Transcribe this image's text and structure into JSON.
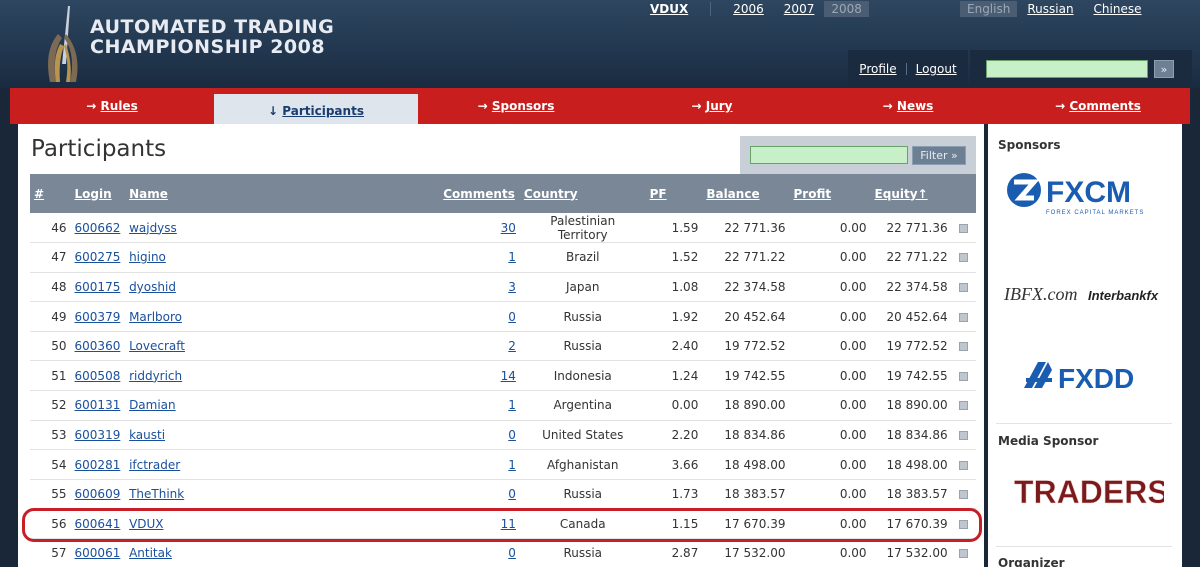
{
  "header": {
    "logo_line1": "AUTOMATED TRADING",
    "logo_line2": "CHAMPIONSHIP 2008",
    "user": "VDUX",
    "years": [
      "2006",
      "2007",
      "2008"
    ],
    "active_year": "2008",
    "languages": [
      "English",
      "Russian",
      "Chinese"
    ],
    "active_language": "English",
    "profile_label": "Profile",
    "logout_label": "Logout",
    "search_placeholder": "",
    "search_go": "»"
  },
  "nav": {
    "items": [
      {
        "label": "Rules",
        "arrow": "→"
      },
      {
        "label": "Participants",
        "arrow": "↓"
      },
      {
        "label": "Sponsors",
        "arrow": "→"
      },
      {
        "label": "Jury",
        "arrow": "→"
      },
      {
        "label": "News",
        "arrow": "→"
      },
      {
        "label": "Comments",
        "arrow": "→"
      }
    ]
  },
  "main": {
    "title": "Participants",
    "filter_label": "Filter »",
    "columns": {
      "num": "#",
      "login": "Login",
      "name": "Name",
      "comments": "Comments",
      "country": "Country",
      "pf": "PF",
      "balance": "Balance",
      "profit": "Profit",
      "equity": "Equity↑"
    },
    "rows": [
      {
        "num": "46",
        "login": "600662",
        "name": "wajdyss",
        "comments": "30",
        "country": "Palestinian Territory",
        "pf": "1.59",
        "balance": "22 771.36",
        "profit": "0.00",
        "equity": "22 771.36"
      },
      {
        "num": "47",
        "login": "600275",
        "name": "higino",
        "comments": "1",
        "country": "Brazil",
        "pf": "1.52",
        "balance": "22 771.22",
        "profit": "0.00",
        "equity": "22 771.22"
      },
      {
        "num": "48",
        "login": "600175",
        "name": "dyoshid",
        "comments": "3",
        "country": "Japan",
        "pf": "1.08",
        "balance": "22 374.58",
        "profit": "0.00",
        "equity": "22 374.58"
      },
      {
        "num": "49",
        "login": "600379",
        "name": "Marlboro",
        "comments": "0",
        "country": "Russia",
        "pf": "1.92",
        "balance": "20 452.64",
        "profit": "0.00",
        "equity": "20 452.64"
      },
      {
        "num": "50",
        "login": "600360",
        "name": "Lovecraft",
        "comments": "2",
        "country": "Russia",
        "pf": "2.40",
        "balance": "19 772.52",
        "profit": "0.00",
        "equity": "19 772.52"
      },
      {
        "num": "51",
        "login": "600508",
        "name": "riddyrich",
        "comments": "14",
        "country": "Indonesia",
        "pf": "1.24",
        "balance": "19 742.55",
        "profit": "0.00",
        "equity": "19 742.55"
      },
      {
        "num": "52",
        "login": "600131",
        "name": "Damian",
        "comments": "1",
        "country": "Argentina",
        "pf": "0.00",
        "balance": "18 890.00",
        "profit": "0.00",
        "equity": "18 890.00"
      },
      {
        "num": "53",
        "login": "600319",
        "name": "kausti",
        "comments": "0",
        "country": "United States",
        "pf": "2.20",
        "balance": "18 834.86",
        "profit": "0.00",
        "equity": "18 834.86"
      },
      {
        "num": "54",
        "login": "600281",
        "name": "ifctrader",
        "comments": "1",
        "country": "Afghanistan",
        "pf": "3.66",
        "balance": "18 498.00",
        "profit": "0.00",
        "equity": "18 498.00"
      },
      {
        "num": "55",
        "login": "600609",
        "name": "TheThink",
        "comments": "0",
        "country": "Russia",
        "pf": "1.73",
        "balance": "18 383.57",
        "profit": "0.00",
        "equity": "18 383.57"
      },
      {
        "num": "56",
        "login": "600641",
        "name": "VDUX",
        "comments": "11",
        "country": "Canada",
        "pf": "1.15",
        "balance": "17 670.39",
        "profit": "0.00",
        "equity": "17 670.39"
      },
      {
        "num": "57",
        "login": "600061",
        "name": "Antitak",
        "comments": "0",
        "country": "Russia",
        "pf": "2.87",
        "balance": "17 532.00",
        "profit": "0.00",
        "equity": "17 532.00"
      }
    ]
  },
  "sidebar": {
    "sponsors_heading": "Sponsors",
    "media_heading": "Media Sponsor",
    "organizer_heading": "Organizer",
    "logos": {
      "fxcm": "FXCM",
      "fxcm_sub": "FOREX CAPITAL MARKETS",
      "ibfx": "IBFX.com",
      "interbank": "Interbankfx",
      "fxdd": "FXDD",
      "traders": "TRADERS´"
    }
  },
  "colors": {
    "nav_red": "#c81e1e",
    "header_navy": "#223850",
    "link_blue": "#1a4f9c",
    "highlight_ring": "#c81e28",
    "fxcm_blue": "#1a5db0"
  }
}
